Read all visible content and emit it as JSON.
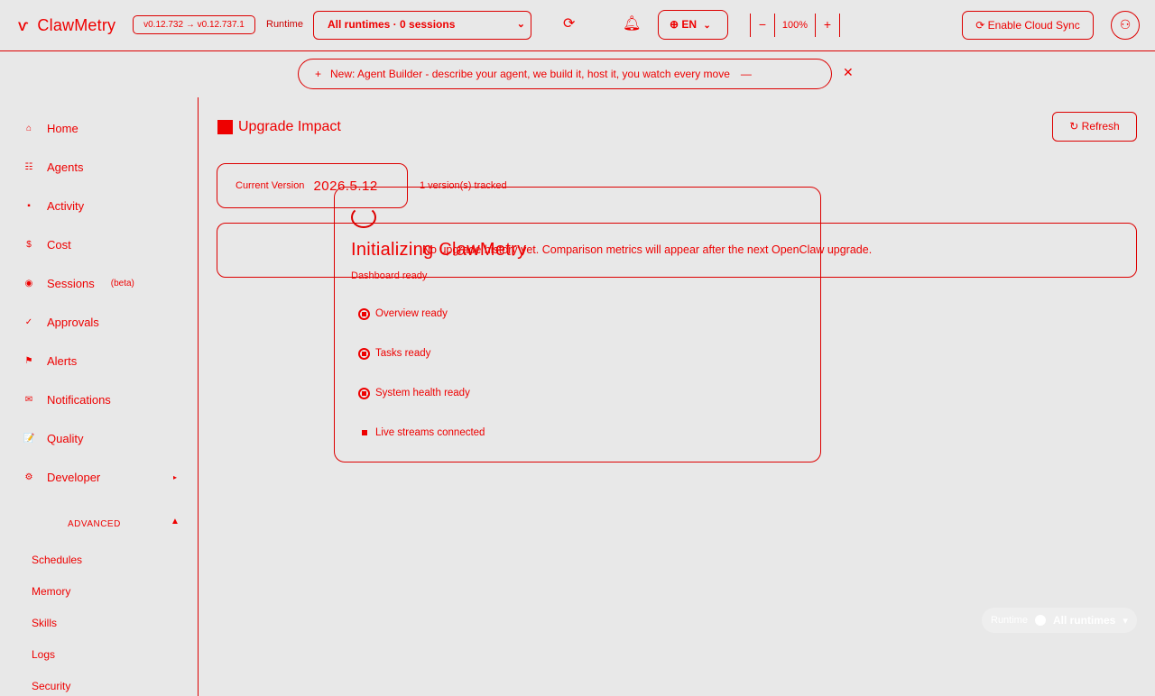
{
  "header": {
    "app_name": "ClawMetry",
    "logo_icon": "claw-icon",
    "version_badge": "v0.12.732 → v0.12.737.1",
    "runtime_label": "Runtime",
    "runtime_select": "All runtimes · 0 sessions",
    "lang": "EN",
    "zoom_minus": "−",
    "zoom_value": "100%",
    "zoom_plus": "+",
    "cloud_sync": "Enable Cloud Sync"
  },
  "announcement": {
    "plus": "+",
    "text": "New: Agent Builder - describe your agent, we build it, host it, you watch every move",
    "dash": "—",
    "close": "✕"
  },
  "sidebar": {
    "items": [
      {
        "label": "Home",
        "icon": "home-icon",
        "glyph": "⌂"
      },
      {
        "label": "Agents",
        "icon": "grid-icon",
        "glyph": "☷"
      },
      {
        "label": "Activity",
        "icon": "activity-icon",
        "glyph": "▪"
      },
      {
        "label": "Cost",
        "icon": "dollar-icon",
        "glyph": "$"
      },
      {
        "label": "Sessions",
        "icon": "sessions-icon",
        "glyph": "◉",
        "badge": "(beta)"
      },
      {
        "label": "Approvals",
        "icon": "check-icon",
        "glyph": "✓"
      },
      {
        "label": "Alerts",
        "icon": "flag-icon",
        "glyph": "⚑"
      },
      {
        "label": "Notifications",
        "icon": "mail-icon",
        "glyph": "✉"
      },
      {
        "label": "Quality",
        "icon": "clipboard-icon",
        "glyph": "📝"
      },
      {
        "label": "Developer",
        "icon": "gear-icon",
        "glyph": "⚙",
        "caret": "▸"
      }
    ],
    "advanced_header": "ADVANCED",
    "advanced_caret": "▲",
    "advanced_items": [
      "Schedules",
      "Memory",
      "Skills",
      "Logs",
      "Security"
    ]
  },
  "main": {
    "title": "Upgrade Impact",
    "refresh": "↻ Refresh",
    "current_version_label": "Current Version",
    "current_version": "2026.5.12",
    "tracked": "1 version(s) tracked",
    "empty_message": "No upgrade history yet. Comparison metrics will appear after the next OpenClaw upgrade."
  },
  "modal": {
    "title": "Initializing ClawMetry",
    "subtitle": "Dashboard ready",
    "steps": [
      {
        "label": "Overview ready",
        "state": "done"
      },
      {
        "label": "Tasks ready",
        "state": "done"
      },
      {
        "label": "System health ready",
        "state": "done"
      },
      {
        "label": "Live streams connected",
        "state": "active"
      }
    ]
  },
  "runtime_pill": {
    "label": "Runtime",
    "value": "All runtimes",
    "chevron": "▾"
  },
  "colors": {
    "accent": "#ee0000",
    "background": "#e8e8e8"
  }
}
